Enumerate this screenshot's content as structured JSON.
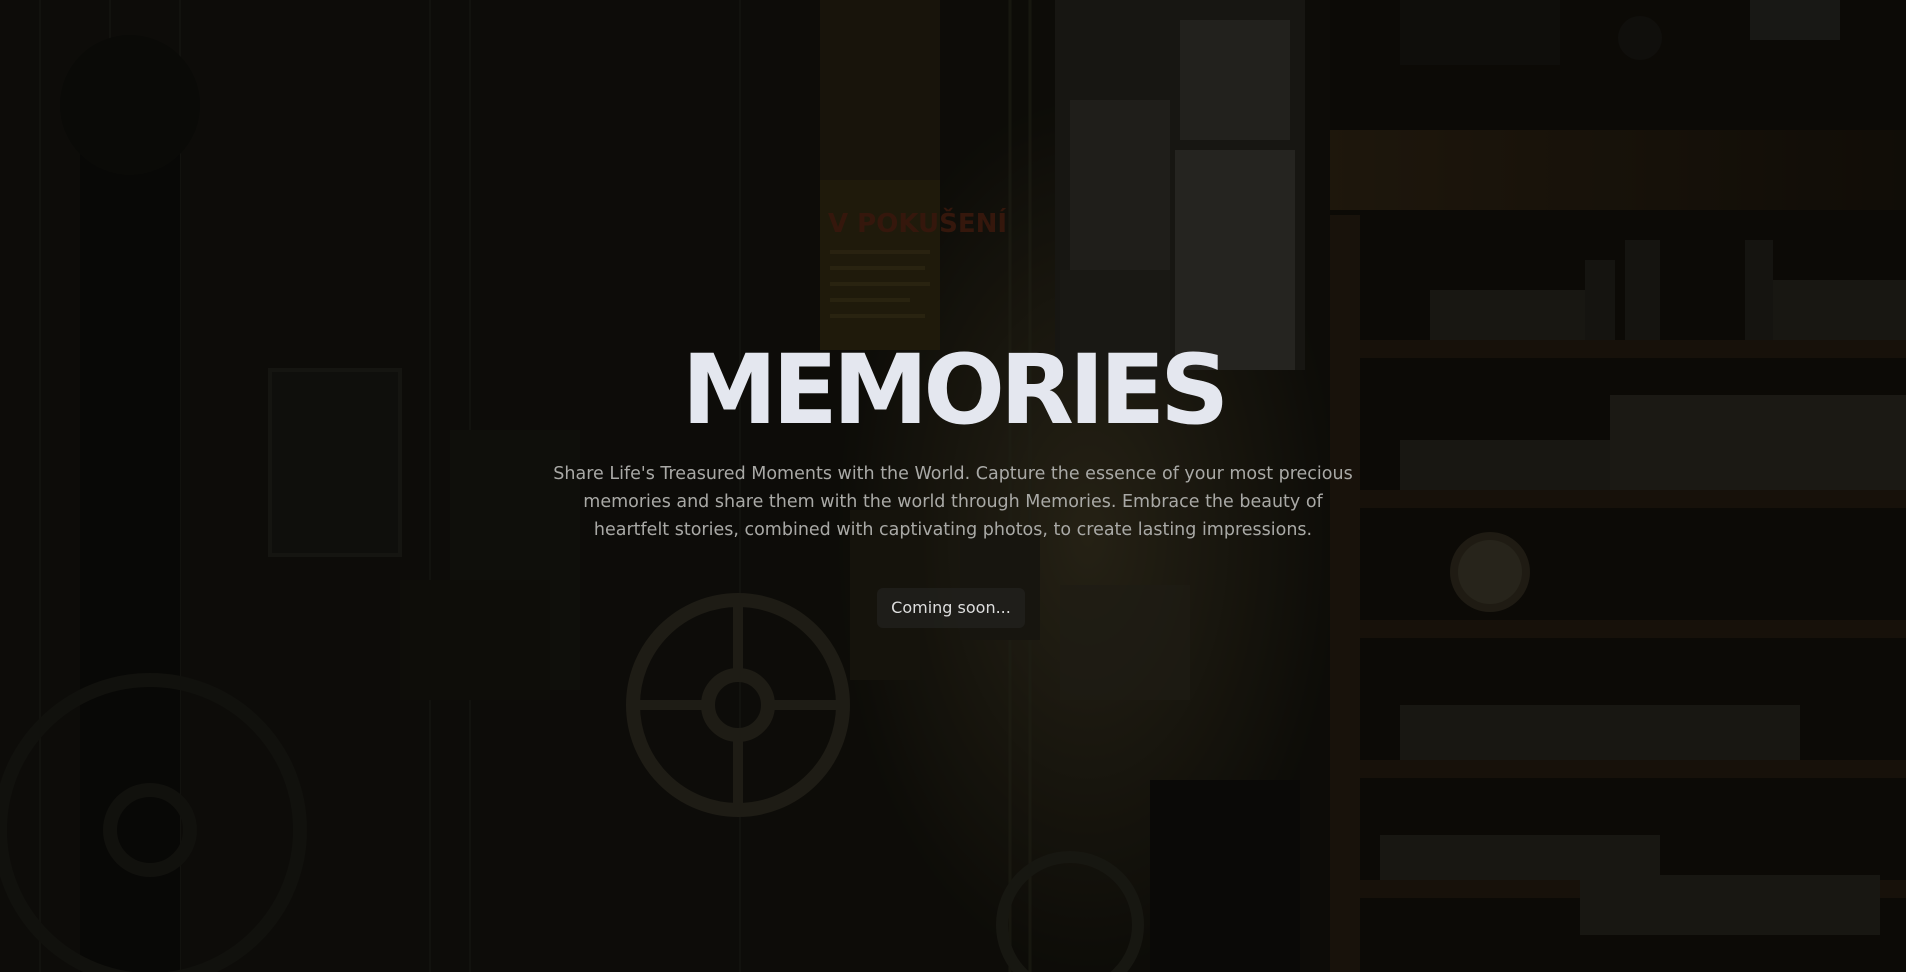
{
  "hero": {
    "title": "MEMORIES",
    "description": "Share Life's Treasured Moments with the World. Capture the essence of your most precious memories and share them with the world through Memories. Embrace the beauty of heartfelt stories, combined with captivating photos, to create lasting impressions.",
    "cta_label": "Coming soon..."
  },
  "colors": {
    "title": "#e4e7ef",
    "description": "#a9a9a6",
    "button_text": "#dedede",
    "background_overlay": "#080806"
  },
  "background": {
    "poster_text": "V POKUŠENÍ"
  }
}
